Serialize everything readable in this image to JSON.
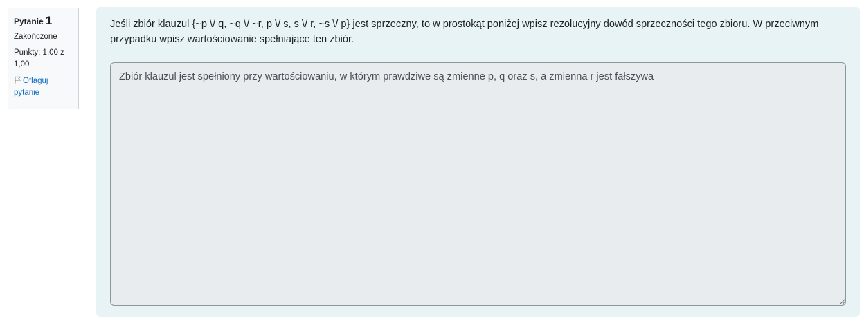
{
  "question_info": {
    "label": "Pytanie",
    "number": "1",
    "state": "Zakończone",
    "grade": "Punkty: 1,00 z 1,00",
    "flag_label": "Oflaguj pytanie"
  },
  "question": {
    "text": "Jeśli zbiór klauzul {~p \\/ q, ~q \\/ ~r, p \\/ s, s \\/ r, ~s \\/ p} jest sprzeczny, to w prostokąt poniżej wpisz rezolucyjny dowód sprzeczności tego zbioru. W przeciwnym przypadku wpisz wartościowanie spełniające ten zbiór."
  },
  "answer": {
    "value": "Zbiór klauzul jest spełniony przy wartościowaniu, w którym prawdziwe są zmienne p, q oraz s, a zmienna r jest fałszywa"
  },
  "colors": {
    "panel_bg": "#e7f3f5",
    "info_bg": "#f8f9fa",
    "textarea_bg": "#e9ecef",
    "link": "#0f6cbf"
  },
  "icons": {
    "flag": "flag-icon",
    "resize": "resize-grip-icon"
  }
}
